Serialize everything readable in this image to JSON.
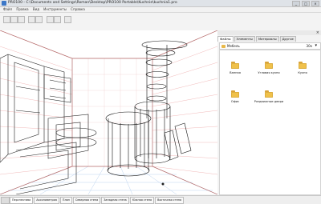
{
  "window": {
    "title": "PRO100 - C:\\Documents and Settings\\Roman\\Desktop\\PRO100 Portable\\Kuchnie\\kuchnia1.pro",
    "buttons": [
      "_",
      "□",
      "×"
    ]
  },
  "menu": {
    "items": [
      "Файл",
      "Правка",
      "Вид",
      "Инструменты",
      "Справка"
    ]
  },
  "library_panel": {
    "tabs": [
      "Файлы",
      "Элементы",
      "Материалы",
      "Другое"
    ],
    "active_tab": 0,
    "path_label": "Мебель",
    "zoom_label": "30x",
    "items": [
      {
        "label": "Ванная"
      },
      {
        "label": "Угловая кухня"
      },
      {
        "label": "Кухня"
      },
      {
        "label": "Офис"
      },
      {
        "label": "Раздвижные двери"
      }
    ]
  },
  "view_tabs": [
    "Перспектива",
    "Аксонометрия",
    "План",
    "Северная стена",
    "Западная стена",
    "Южная стена",
    "Восточная стена"
  ],
  "active_view_tab": 0,
  "colors": {
    "folder": "#f0c14a",
    "viewport_bg": "#ffffff"
  }
}
